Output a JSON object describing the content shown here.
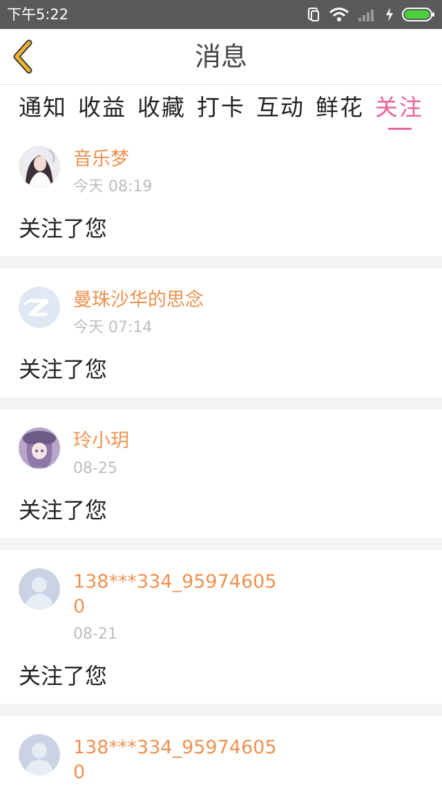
{
  "status_bar": {
    "time": "下午5:22"
  },
  "nav": {
    "title": "消息"
  },
  "tabs": [
    {
      "label": "通知"
    },
    {
      "label": "收益"
    },
    {
      "label": "收藏"
    },
    {
      "label": "打卡"
    },
    {
      "label": "互动"
    },
    {
      "label": "鲜花"
    },
    {
      "label": "关注",
      "active": true
    }
  ],
  "messages": [
    {
      "name": "音乐梦",
      "time": "今天 08:19",
      "text": "关注了您",
      "avatar": "photo-girl-white"
    },
    {
      "name": "曼珠沙华的思念",
      "time": "今天 07:14",
      "text": "关注了您",
      "avatar": "default-z-logo"
    },
    {
      "name": "玲小玥",
      "time": "08-25",
      "text": "关注了您",
      "avatar": "anime-girl-purple"
    },
    {
      "name": "138***334_959746050",
      "time": "08-21",
      "text": "关注了您",
      "avatar": "default-person"
    },
    {
      "name": "138***334_959746050",
      "time": "",
      "text": "",
      "avatar": "default-person"
    }
  ],
  "colors": {
    "accent": "#e8639d",
    "username": "#ee9150",
    "back_arrow": "#f0b62a",
    "separator": "#f3f3f3"
  }
}
